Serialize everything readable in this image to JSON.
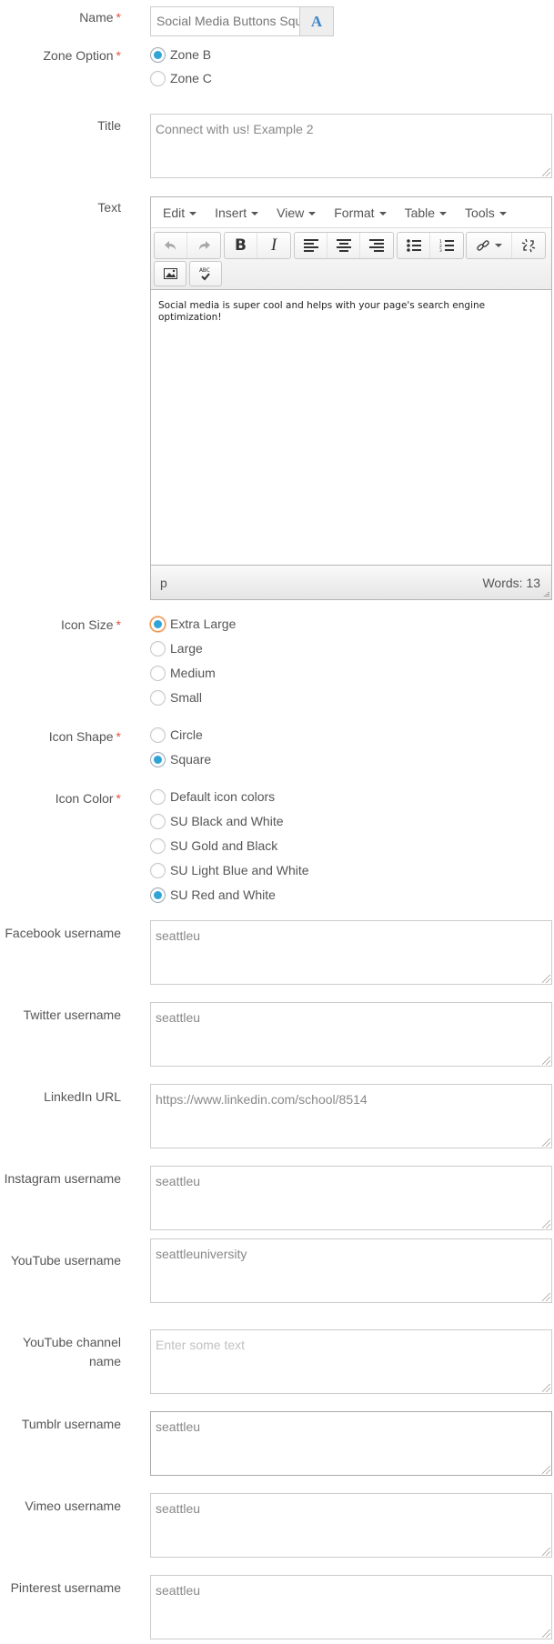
{
  "form": {
    "name": {
      "label": "Name",
      "required": "*",
      "value": "Social Media Buttons Squ",
      "addon_icon": "font-A-icon",
      "addon_glyph": "A"
    },
    "zone_option": {
      "label": "Zone Option",
      "required": "*",
      "options": [
        {
          "label": "Zone B",
          "checked": true
        },
        {
          "label": "Zone C",
          "checked": false
        }
      ]
    },
    "title": {
      "label": "Title",
      "value": "Connect with us! Example 2"
    },
    "text": {
      "label": "Text",
      "menu": [
        "Edit",
        "Insert",
        "View",
        "Format",
        "Table",
        "Tools"
      ],
      "toolbar": {
        "buttons": [
          "undo",
          "redo",
          "bold",
          "italic",
          "align-left",
          "align-center",
          "align-right",
          "bullet-list",
          "numbered-list",
          "link",
          "unlink",
          "image",
          "spellcheck"
        ]
      },
      "content": "Social media is super cool and helps with your page's search engine optimization!",
      "status_path": "p",
      "word_count": "Words: 13"
    },
    "icon_size": {
      "label": "Icon Size",
      "required": "*",
      "options": [
        {
          "label": "Extra Large",
          "checked": true
        },
        {
          "label": "Large",
          "checked": false
        },
        {
          "label": "Medium",
          "checked": false
        },
        {
          "label": "Small",
          "checked": false
        }
      ]
    },
    "icon_shape": {
      "label": "Icon Shape",
      "required": "*",
      "options": [
        {
          "label": "Circle",
          "checked": false
        },
        {
          "label": "Square",
          "checked": true
        }
      ]
    },
    "icon_color": {
      "label": "Icon Color",
      "required": "*",
      "options": [
        {
          "label": "Default icon colors",
          "checked": false
        },
        {
          "label": "SU Black and White",
          "checked": false
        },
        {
          "label": "SU Gold and Black",
          "checked": false
        },
        {
          "label": "SU Light Blue and White",
          "checked": false
        },
        {
          "label": "SU Red and White",
          "checked": true
        }
      ]
    },
    "social": [
      {
        "label": "Facebook username",
        "value": "seattleu"
      },
      {
        "label": "Twitter username",
        "value": "seattleu"
      },
      {
        "label": "LinkedIn URL",
        "value": "https://www.linkedin.com/school/8514"
      },
      {
        "label": "Instagram username",
        "value": "seattleu"
      },
      {
        "label": "YouTube username",
        "value": "seattleuniversity"
      },
      {
        "label_line1": "YouTube channel",
        "label_line2": "name",
        "value": "",
        "placeholder": "Enter some text"
      },
      {
        "label": "Tumblr username",
        "value": "seattleu"
      },
      {
        "label": "Vimeo username",
        "value": "seattleu"
      },
      {
        "label": "Pinterest username",
        "value": "seattleu"
      }
    ]
  },
  "colors": {
    "required_asterisk": "#e0543e",
    "radio_checked": "#2fa4d7",
    "addon_icon": "#3f85c6"
  }
}
